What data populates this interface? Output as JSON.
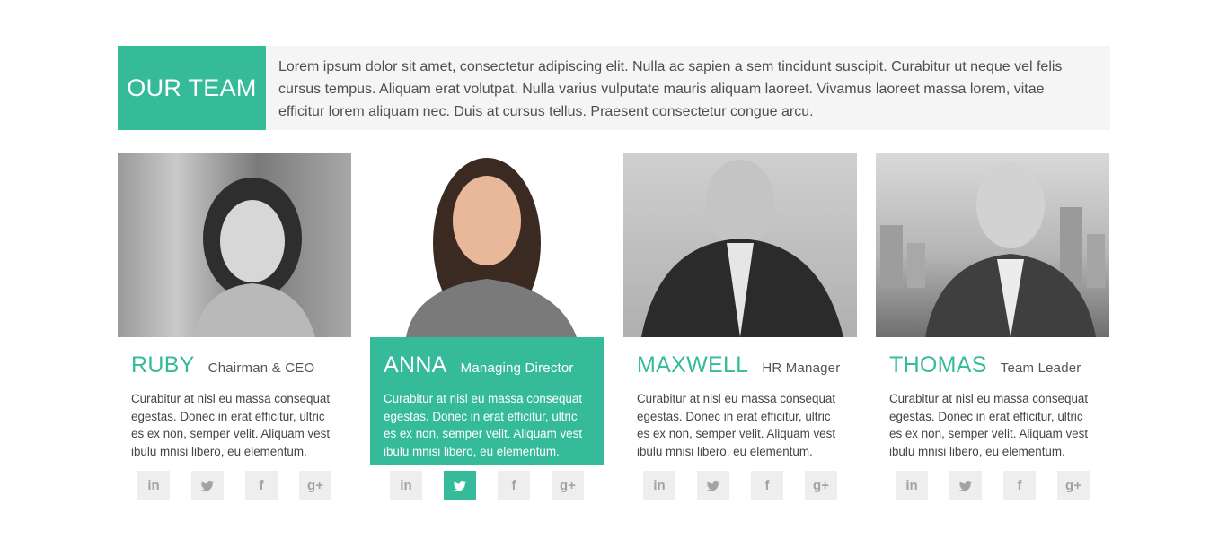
{
  "section": {
    "title": "OUR TEAM",
    "intro": "Lorem ipsum dolor sit amet, consectetur adipiscing elit. Nulla ac sapien a sem tincidunt suscipit. Curabitur ut neque vel felis cursus tempus. Aliquam erat volutpat. Nulla varius vulputate mauris aliquam laoreet. Vivamus laoreet massa lorem, vitae efficitur lorem aliquam nec. Duis at cursus tellus. Praesent consectetur congue arcu."
  },
  "accent_color": "#36bb9a",
  "social_icons": {
    "linkedin": "in",
    "twitter": "twitter-bird-icon",
    "facebook": "f",
    "googleplus": "g+"
  },
  "members": [
    {
      "name": "RUBY",
      "role": "Chairman & CEO",
      "bio": "Curabitur at nisl eu massa consequat egestas. Donec in erat efficitur, ultric es ex non, semper velit. Aliquam vest ibulu mnisi libero, eu elementum.",
      "active": false
    },
    {
      "name": "ANNA",
      "role": "Managing Director",
      "bio": "Curabitur at nisl eu massa consequat egestas. Donec in erat efficitur, ultric es ex non, semper velit. Aliquam vest ibulu mnisi libero, eu elementum.",
      "active": true
    },
    {
      "name": "MAXWELL",
      "role": "HR Manager",
      "bio": "Curabitur at nisl eu massa consequat egestas. Donec in erat efficitur, ultric es ex non, semper velit. Aliquam vest ibulu mnisi libero, eu elementum.",
      "active": false
    },
    {
      "name": "THOMAS",
      "role": "Team Leader",
      "bio": "Curabitur at nisl eu massa consequat egestas. Donec in erat efficitur, ultric es ex non, semper velit. Aliquam vest ibulu mnisi libero, eu elementum.",
      "active": false
    }
  ]
}
